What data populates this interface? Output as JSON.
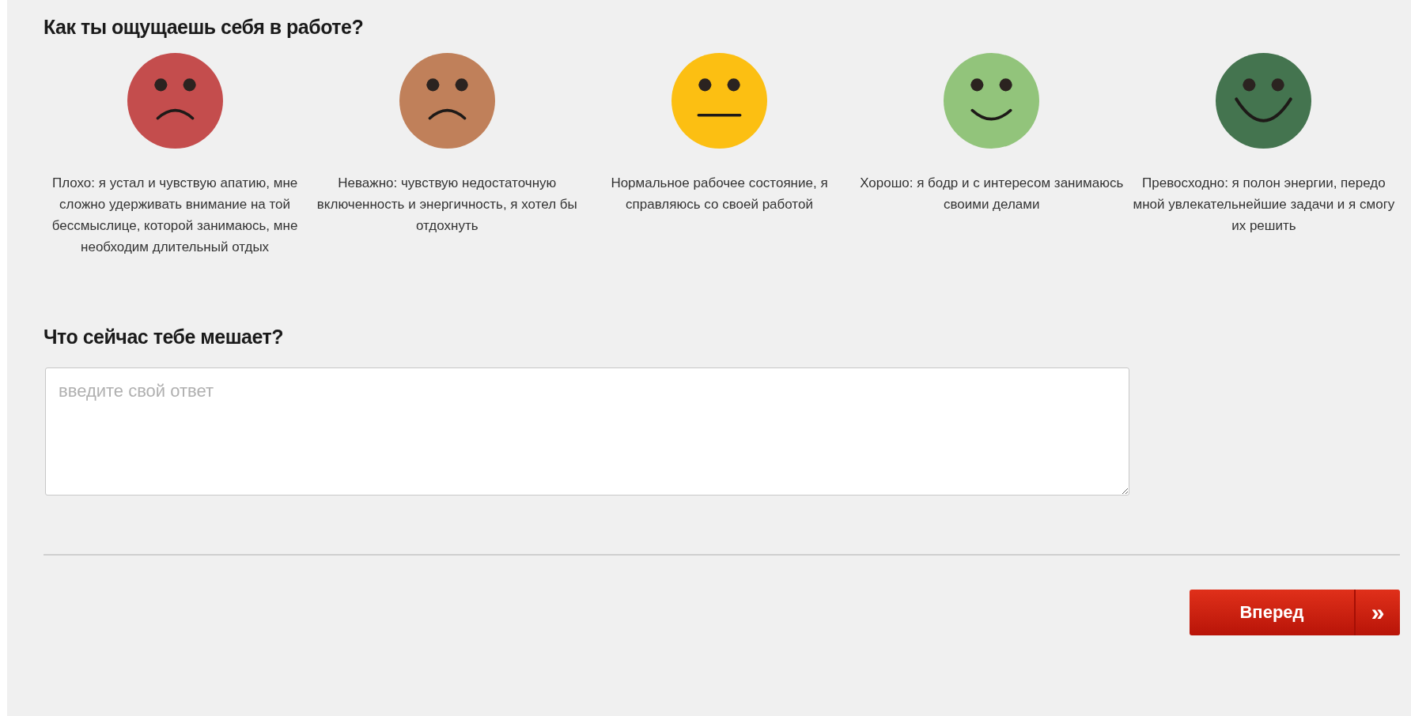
{
  "question_1": {
    "title": "Как ты ощущаешь себя в работе?",
    "options": [
      {
        "kind": "frown",
        "color": "#c44d4d",
        "label": "Плохо: я устал и чувствую апатию, мне сложно удерживать внимание на той бессмыслице, которой занимаюсь, мне необходим длительный отдых"
      },
      {
        "kind": "frown",
        "color": "#c0805a",
        "label": "Неважно: чувствую недостаточную включенность и энергичность, я хотел бы отдохнуть"
      },
      {
        "kind": "neutral",
        "color": "#fcbf12",
        "label": "Нормальное рабочее состояние, я справляюсь со своей работой"
      },
      {
        "kind": "smile",
        "color": "#92c47b",
        "label": "Хорошо: я бодр и с интересом занимаюсь своими делами"
      },
      {
        "kind": "grin",
        "color": "#44744f",
        "label": "Превосходно: я полон энергии, передо мной увлекательнейшие задачи и я смогу их решить"
      }
    ]
  },
  "question_2": {
    "title": "Что сейчас тебе мешает?",
    "answer": {
      "placeholder": "введите свой ответ"
    }
  },
  "next_button": {
    "label": "Вперед",
    "arrow": "»"
  }
}
